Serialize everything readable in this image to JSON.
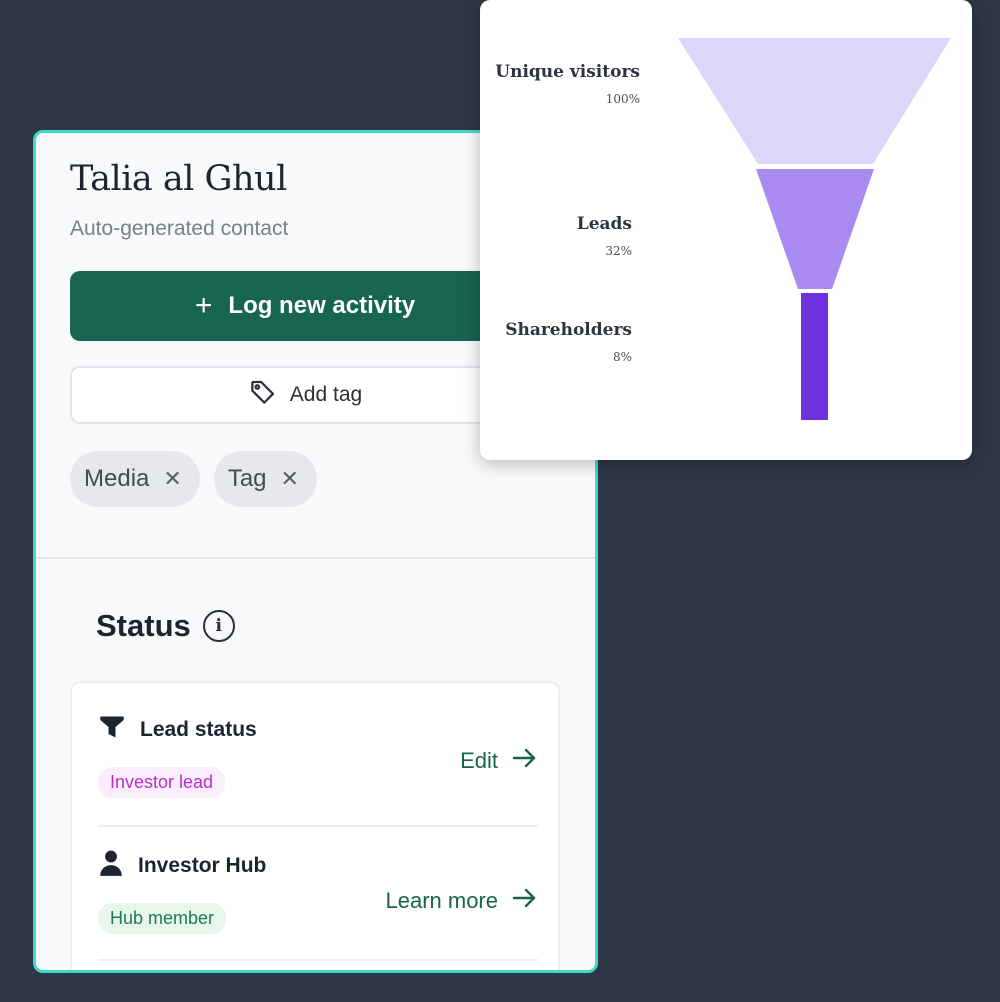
{
  "contact": {
    "name": "Talia al Ghul",
    "subtitle": "Auto-generated contact",
    "log_button": {
      "icon": "plus-icon",
      "label": "Log new activity"
    },
    "tag_button": {
      "icon": "tag-icon",
      "label": "Add tag"
    },
    "tags": [
      {
        "label": "Media",
        "remove": "✕"
      },
      {
        "label": "Tag",
        "remove": "✕"
      }
    ]
  },
  "status": {
    "title": "Status",
    "info_icon": "info-icon",
    "rows": [
      {
        "icon": "funnel-icon",
        "title": "Lead status",
        "badge": "Investor lead",
        "link": "Edit",
        "link_icon": "arrow-right-icon"
      },
      {
        "icon": "person-icon",
        "title": "Investor Hub",
        "badge": "Hub member",
        "link": "Learn more",
        "link_icon": "arrow-right-icon"
      }
    ]
  },
  "colors": {
    "page_bg": "#2e3746",
    "card_border": "#3fd9c8",
    "primary_button": "#17644f",
    "lead_badge_text": "#b82ec7",
    "hub_badge_text": "#1f7a4f",
    "funnel_stage_1": "#dcd6fb",
    "funnel_stage_2": "#a88af0",
    "funnel_stage_3": "#6d32dd"
  },
  "funnel": {
    "stages": [
      {
        "label": "Unique visitors",
        "percent": "100%"
      },
      {
        "label": "Leads",
        "percent": "32%"
      },
      {
        "label": "Shareholders",
        "percent": "8%"
      }
    ]
  }
}
